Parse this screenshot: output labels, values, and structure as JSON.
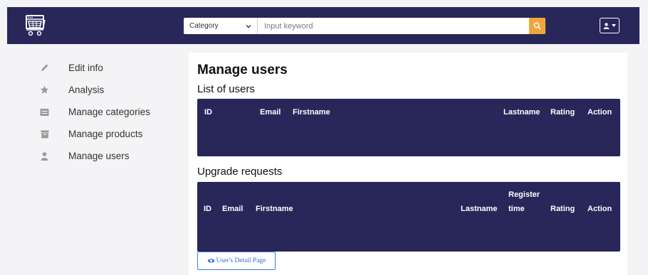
{
  "navbar": {
    "category_label": "Category",
    "search_placeholder": "Input keyword",
    "accent": "#29265a",
    "search_button_color": "#f0a63b"
  },
  "sidebar": {
    "items": [
      {
        "label": "Edit info",
        "icon": "pencil-icon"
      },
      {
        "label": "Analysis",
        "icon": "star-icon"
      },
      {
        "label": "Manage categories",
        "icon": "list-icon"
      },
      {
        "label": "Manage products",
        "icon": "archive-icon"
      },
      {
        "label": "Manage users",
        "icon": "user-icon"
      }
    ]
  },
  "main": {
    "title": "Manage users",
    "users_section": {
      "heading": "List of users",
      "columns": [
        "ID",
        "Email",
        "Firstname",
        "Lastname",
        "Rating",
        "Action"
      ]
    },
    "requests_section": {
      "heading": "Upgrade requests",
      "columns": [
        "ID",
        "Email",
        "Firstname",
        "Lastname",
        "Register",
        "time",
        "Rating",
        "Action"
      ]
    },
    "detail_button_label": "User's Detail Page"
  }
}
